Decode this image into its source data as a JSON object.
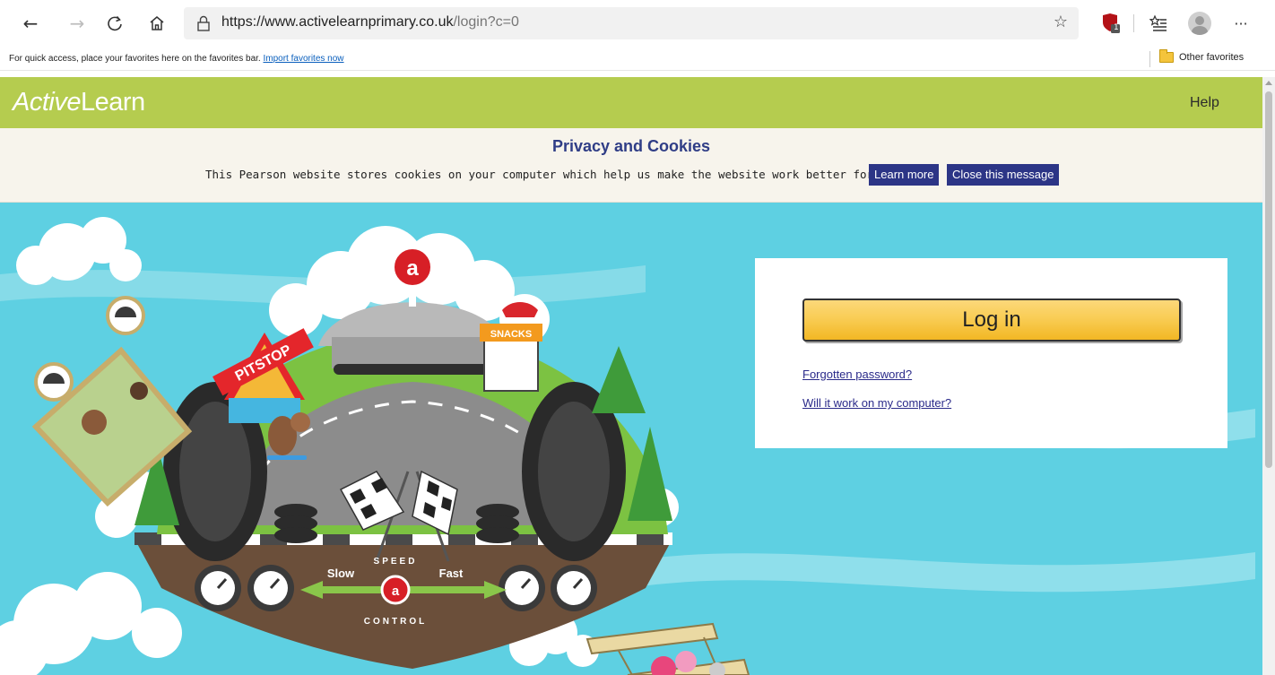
{
  "browser": {
    "url_host": "https://www.activelearnprimary.co.uk",
    "url_path": "/login?c=0",
    "extension_badge": "1",
    "favorites_bar": {
      "message": "For quick access, place your favorites here on the favorites bar.",
      "import_link": "Import favorites now",
      "other_favorites": "Other favorites"
    },
    "icons": [
      "back-arrow-icon",
      "forward-arrow-icon",
      "refresh-icon",
      "home-icon",
      "lock-icon",
      "favorite-star-icon",
      "extension-shield-icon",
      "favorites-list-icon",
      "profile-avatar-icon",
      "more-options-icon",
      "folder-icon"
    ]
  },
  "site": {
    "logo_italic": "Active",
    "logo_regular": "Learn",
    "help_label": "Help"
  },
  "cookie_notice": {
    "title": "Privacy and Cookies",
    "text": "This Pearson website stores cookies on your computer which help us make the website work better for you.",
    "learn_more": "Learn more",
    "close": "Close this message"
  },
  "login": {
    "button_label": "Log in",
    "forgotten_password": "Forgotten password?",
    "compatibility": "Will it work on my computer?"
  },
  "hero": {
    "pitstop_sign": "PITSTOP",
    "snacks_sign": "SNACKS",
    "slow_label": "Slow",
    "fast_label": "Fast",
    "speed_label": "SPEED",
    "control_label": "CONTROL",
    "badge_letter": "a"
  },
  "colors": {
    "header_green": "#b5cc4f",
    "sky_blue": "#5ed0e2",
    "cookie_button_navy": "#2c3586",
    "login_button_yellow": "#f9cd55"
  }
}
